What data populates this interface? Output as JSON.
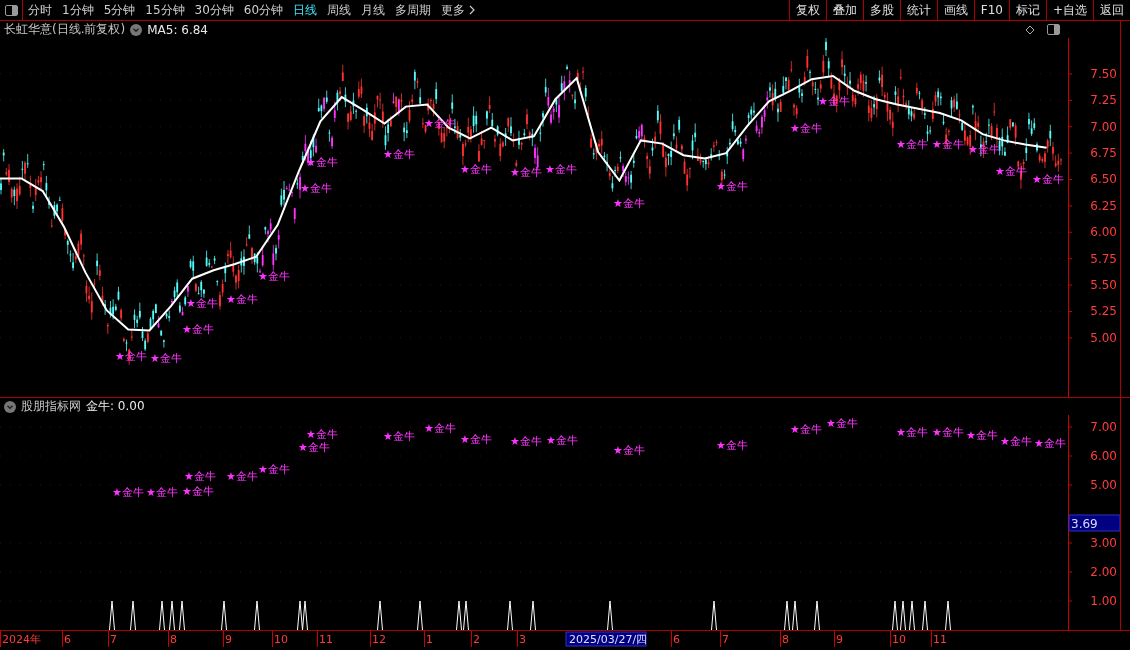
{
  "toolbar": {
    "tabs": [
      {
        "label": "分时",
        "selected": false
      },
      {
        "label": "1分钟",
        "selected": false
      },
      {
        "label": "5分钟",
        "selected": false
      },
      {
        "label": "15分钟",
        "selected": false
      },
      {
        "label": "30分钟",
        "selected": false
      },
      {
        "label": "60分钟",
        "selected": false
      },
      {
        "label": "日线",
        "selected": true
      },
      {
        "label": "周线",
        "selected": false
      },
      {
        "label": "月线",
        "selected": false
      },
      {
        "label": "多周期",
        "selected": false
      },
      {
        "label": "更多",
        "selected": false
      }
    ],
    "buttons": [
      "复权",
      "叠加",
      "多股",
      "统计",
      "画线",
      "F10",
      "标记",
      "+自选",
      "返回"
    ]
  },
  "price_panel": {
    "title": "长虹华意(日线.前复权)",
    "indicator": "MA5: 6.84",
    "chart_data": {
      "type": "line",
      "ylim": [
        4.44,
        7.84
      ],
      "categories": [
        null,
        null,
        null,
        null,
        null,
        null,
        null,
        null,
        null,
        null,
        null,
        null,
        null,
        null,
        null,
        null,
        null,
        null,
        null,
        null,
        null,
        null,
        null,
        null,
        null,
        null,
        null,
        null,
        null,
        null,
        null,
        null,
        null,
        null,
        null,
        null,
        null,
        null,
        null,
        null,
        null,
        null,
        null,
        null,
        null,
        null,
        null,
        null,
        null,
        null
      ],
      "series": [
        {
          "color": "#ffffff",
          "values": [
            6.51,
            6.51,
            6.39,
            6.05,
            5.62,
            5.26,
            5.08,
            5.07,
            5.3,
            5.56,
            5.64,
            5.7,
            5.77,
            6.07,
            6.58,
            7.05,
            7.28,
            7.16,
            7.03,
            7.19,
            7.21,
            6.99,
            6.89,
            6.99,
            6.87,
            6.91,
            7.26,
            7.46,
            6.76,
            6.49,
            6.87,
            6.84,
            6.73,
            6.7,
            6.75,
            7.01,
            7.24,
            7.34,
            7.45,
            7.48,
            7.34,
            7.26,
            7.21,
            7.17,
            7.13,
            7.06,
            6.93,
            6.87,
            6.83,
            6.8
          ]
        }
      ],
      "yticks": [
        {
          "value": 7.5,
          "label": "7.50"
        },
        {
          "value": 7.25,
          "label": "7.25"
        },
        {
          "value": 7.0,
          "label": "7.00"
        },
        {
          "value": 6.75,
          "label": "6.75"
        },
        {
          "value": 6.5,
          "label": "6.50"
        },
        {
          "value": 6.25,
          "label": "6.25"
        },
        {
          "value": 6.0,
          "label": "6.00"
        },
        {
          "value": 5.75,
          "label": "5.75"
        },
        {
          "value": 5.5,
          "label": "5.50"
        },
        {
          "value": 5.25,
          "label": "5.25"
        },
        {
          "value": 5.0,
          "label": "5.00"
        }
      ]
    },
    "signals": [
      "★金牛",
      "★金牛",
      "★金牛",
      "★金牛",
      "★金牛",
      "★金牛",
      "★金牛",
      "★金牛",
      "★金牛",
      "★金牛",
      "★金牛",
      "★金牛",
      "★金牛",
      "★金牛",
      "★金牛",
      "★金牛",
      "★金牛",
      "★金牛",
      "★金牛",
      "★金牛",
      "★金牛",
      "★金牛"
    ]
  },
  "indicator_panel": {
    "title": "股朋指标网",
    "indicator": "金牛: 0.00",
    "cursor_value": "3.69",
    "axis_labels": [
      "7.00",
      "6.00",
      "5.00",
      "3.00",
      "2.00",
      "1.00"
    ],
    "signals": [
      "★金牛",
      "★金牛",
      "★金牛",
      "★金牛",
      "★金牛",
      "★金牛",
      "★金牛",
      "★金牛",
      "★金牛",
      "★金牛",
      "★金牛",
      "★金牛",
      "★金牛",
      "★金牛",
      "★金牛",
      "★金牛",
      "★金牛",
      "★金牛",
      "★金牛",
      "★金牛",
      "★金牛",
      "★金牛"
    ]
  },
  "date_axis": {
    "labels": [
      "2024年",
      "6",
      "7",
      "8",
      "9",
      "10",
      "11",
      "12",
      "1",
      "2",
      "3",
      "6",
      "7",
      "8",
      "9",
      "10",
      "11"
    ],
    "cursor_date": "2025/03/27/四"
  }
}
